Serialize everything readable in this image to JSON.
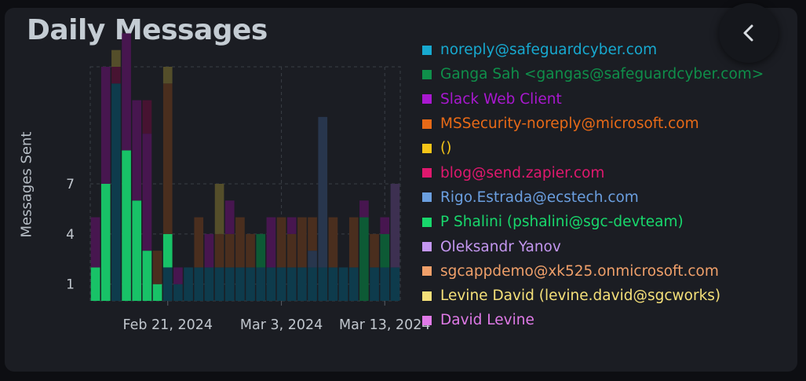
{
  "title": "Daily Messages",
  "chart_data": {
    "type": "bar",
    "stacked": true,
    "ylabel": "Messages Sent",
    "xlabel": "",
    "y_ticks": [
      1,
      4,
      7
    ],
    "ylim": [
      0,
      14
    ],
    "x_ticks": [
      "Feb 21, 2024",
      "Mar 3, 2024",
      "Mar 13, 2024"
    ],
    "x_tick_index": [
      7,
      18,
      28
    ],
    "grid": true,
    "legend_position": "right",
    "bars": [
      [
        [
          2,
          1
        ],
        [
          3,
          2
        ]
      ],
      [
        [
          7,
          1
        ],
        [
          7,
          2
        ]
      ],
      [
        [
          13,
          0
        ],
        [
          1,
          5
        ],
        [
          1,
          10
        ]
      ],
      [
        [
          9,
          1
        ],
        [
          7,
          2
        ]
      ],
      [
        [
          6,
          1
        ],
        [
          6,
          2
        ]
      ],
      [
        [
          3,
          1
        ],
        [
          7,
          2
        ],
        [
          2,
          5
        ]
      ],
      [
        [
          1,
          1
        ],
        [
          2,
          3
        ]
      ],
      [
        [
          2,
          0
        ],
        [
          2,
          1
        ],
        [
          9,
          3
        ],
        [
          1,
          10
        ]
      ],
      [
        [
          1,
          0
        ],
        [
          1,
          2
        ]
      ],
      [
        [
          2,
          0
        ]
      ],
      [
        [
          2,
          0
        ],
        [
          3,
          3
        ]
      ],
      [
        [
          2,
          0
        ],
        [
          2,
          2
        ]
      ],
      [
        [
          2,
          0
        ],
        [
          2,
          3
        ],
        [
          3,
          10
        ]
      ],
      [
        [
          2,
          0
        ],
        [
          2,
          3
        ],
        [
          2,
          2
        ]
      ],
      [
        [
          2,
          0
        ],
        [
          3,
          3
        ]
      ],
      [
        [
          2,
          0
        ],
        [
          2,
          3
        ]
      ],
      [
        [
          2,
          0
        ],
        [
          2,
          7
        ]
      ],
      [
        [
          2,
          0
        ],
        [
          3,
          2
        ]
      ],
      [
        [
          2,
          0
        ],
        [
          3,
          3
        ]
      ],
      [
        [
          2,
          0
        ],
        [
          2,
          3
        ],
        [
          1,
          2
        ]
      ],
      [
        [
          2,
          0
        ],
        [
          3,
          3
        ]
      ],
      [
        [
          2,
          0
        ],
        [
          1,
          6
        ],
        [
          2,
          3
        ]
      ],
      [
        [
          2,
          0
        ],
        [
          9,
          6
        ]
      ],
      [
        [
          2,
          0
        ],
        [
          3,
          3
        ]
      ],
      [
        [
          2,
          0
        ]
      ],
      [
        [
          2,
          0
        ],
        [
          3,
          3
        ]
      ],
      [
        [
          5,
          7
        ],
        [
          1,
          2
        ]
      ],
      [
        [
          2,
          0
        ],
        [
          2,
          3
        ]
      ],
      [
        [
          2,
          0
        ],
        [
          2,
          7
        ],
        [
          1,
          2
        ]
      ],
      [
        [
          2,
          0
        ],
        [
          5,
          8
        ]
      ]
    ]
  },
  "legend": [
    {
      "label": "noreply@safeguardcyber.com",
      "color": "#17a9d0"
    },
    {
      "label": "Ganga Sah <gangas@safeguardcyber.com>",
      "color": "#0f8f4a"
    },
    {
      "label": "Slack Web Client",
      "color": "#a918d0"
    },
    {
      "label": "MSSecurity-noreply@microsoft.com",
      "color": "#e86a17"
    },
    {
      "label": "()",
      "color": "#f5c518"
    },
    {
      "label": "blog@send.zapier.com",
      "color": "#e0186e"
    },
    {
      "label": "Rigo.Estrada@ecstech.com",
      "color": "#6b9fe0"
    },
    {
      "label": "P Shalini (pshalini@sgc-devteam)",
      "color": "#18d86c"
    },
    {
      "label": "Oleksandr Yanov",
      "color": "#c497f0"
    },
    {
      "label": "sgcappdemo@xk525.onmicrosoft.com",
      "color": "#f0a06a"
    },
    {
      "label": "Levine David (levine.david@sgcworks)",
      "color": "#f5e079"
    },
    {
      "label": "David Levine",
      "color": "#e07ae8"
    }
  ],
  "bar_colors": [
    "#0e3b4c",
    "#18c267",
    "#47164f",
    "#4a2e1e",
    "#3e4418",
    "#471331",
    "#28364d",
    "#0d5a35",
    "#3d3051",
    "#4b3727",
    "#544e2a"
  ],
  "back_icon": "chevron-left-icon"
}
